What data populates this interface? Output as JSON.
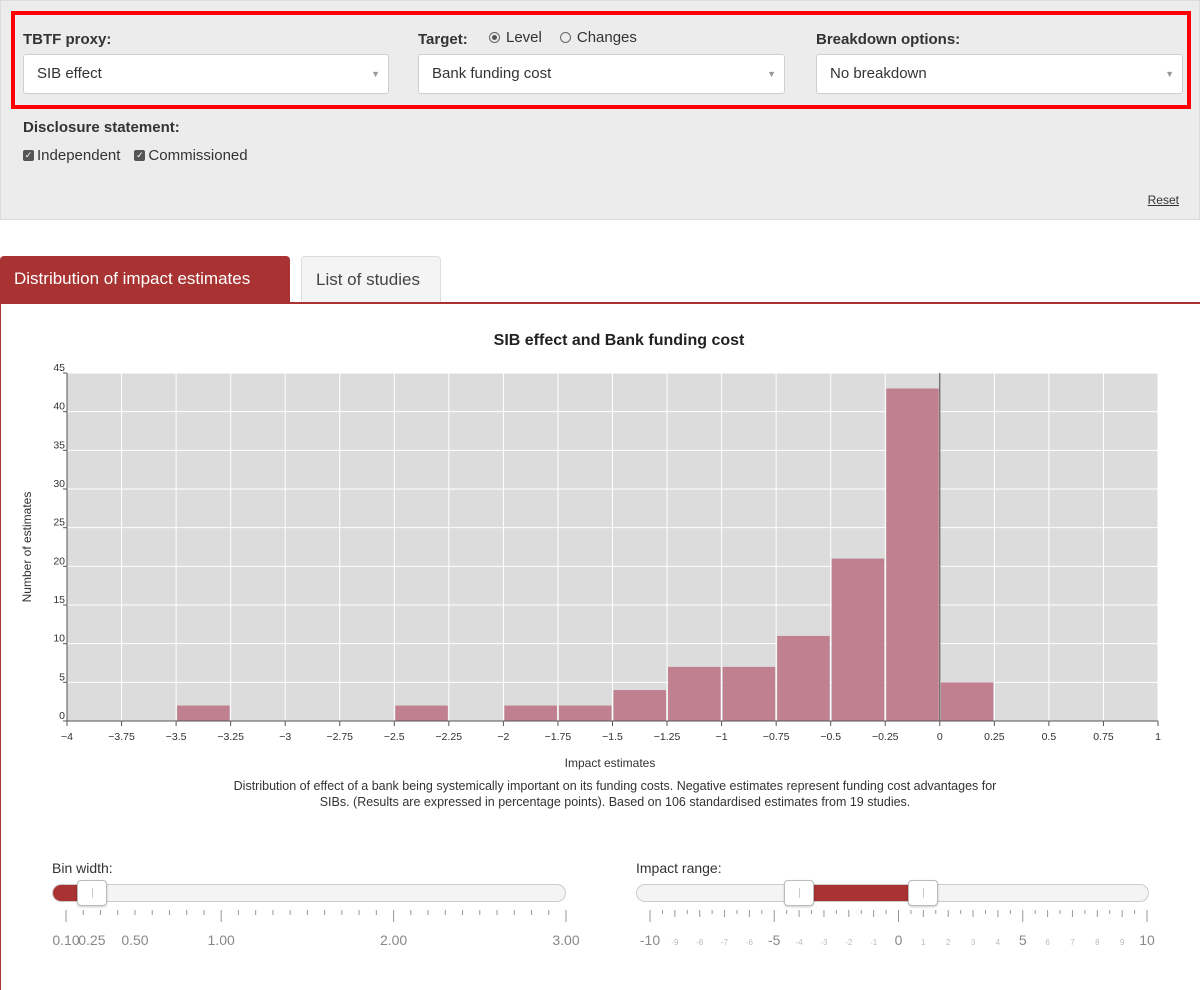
{
  "filters": {
    "tbtf_label": "TBTF proxy:",
    "tbtf_value": "SIB effect",
    "target_label": "Target:",
    "target_options": [
      "Level",
      "Changes"
    ],
    "target_selected": "Level",
    "target_value": "Bank funding cost",
    "breakdown_label": "Breakdown options:",
    "breakdown_value": "No breakdown",
    "disclosure_label": "Disclosure statement:",
    "disclosure_options": [
      "Independent",
      "Commissioned"
    ],
    "reset_label": "Reset",
    "highlight_color": "#ff0000"
  },
  "tabs": [
    {
      "label": "Distribution of impact estimates",
      "active": true
    },
    {
      "label": "List of studies",
      "active": false
    }
  ],
  "accent_color": "#a93232",
  "chart_data": {
    "type": "bar",
    "title": "SIB effect and Bank funding cost",
    "xlabel": "Impact estimates",
    "ylabel": "Number of estimates",
    "xlim": [
      -4,
      1
    ],
    "ylim": [
      0,
      45
    ],
    "bin_width": 0.25,
    "x_ticks": [
      "−4",
      "−3.75",
      "−3.5",
      "−3.25",
      "−3",
      "−2.75",
      "−2.5",
      "−2.25",
      "−2",
      "−1.75",
      "−1.5",
      "−1.25",
      "−1",
      "−0.75",
      "−0.5",
      "−0.25",
      "0",
      "0.25",
      "0.5",
      "0.75",
      "1"
    ],
    "y_ticks": [
      "0",
      "5",
      "10",
      "15",
      "20",
      "25",
      "30",
      "35",
      "40",
      "45"
    ],
    "bins": [
      {
        "start": -3.5,
        "end": -3.25,
        "count": 2
      },
      {
        "start": -2.5,
        "end": -2.25,
        "count": 2
      },
      {
        "start": -2.0,
        "end": -1.75,
        "count": 2
      },
      {
        "start": -1.75,
        "end": -1.5,
        "count": 2
      },
      {
        "start": -1.5,
        "end": -1.25,
        "count": 4
      },
      {
        "start": -1.25,
        "end": -1.0,
        "count": 7
      },
      {
        "start": -1.0,
        "end": -0.75,
        "count": 7
      },
      {
        "start": -0.75,
        "end": -0.5,
        "count": 11
      },
      {
        "start": -0.5,
        "end": -0.25,
        "count": 21
      },
      {
        "start": -0.25,
        "end": 0.0,
        "count": 43
      },
      {
        "start": 0.0,
        "end": 0.25,
        "count": 5
      }
    ],
    "bar_color": "#c08090",
    "plot_bg": "#dcdcdc",
    "grid": true
  },
  "caption": "Distribution of effect of a bank being systemically important on its funding costs. Negative estimates represent funding cost advantages for SIBs. (Results are expressed in percentage points). Based on 106 standardised estimates from 19 studies.",
  "bin_slider": {
    "label": "Bin width:",
    "value": 0.25,
    "min": 0.1,
    "max": 3.0,
    "tick_labels": [
      "0.10",
      "0.25",
      "0.50",
      "1.00",
      "2.00",
      "3.00"
    ]
  },
  "range_slider": {
    "label": "Impact range:",
    "from": -4,
    "to": 1,
    "min": -10,
    "max": 10,
    "tick_labels": [
      "-10",
      "-9",
      "-8",
      "-7",
      "-6",
      "-5",
      "-4",
      "-3",
      "-2",
      "-1",
      "0",
      "1",
      "2",
      "3",
      "4",
      "5",
      "6",
      "7",
      "8",
      "9",
      "10"
    ]
  }
}
